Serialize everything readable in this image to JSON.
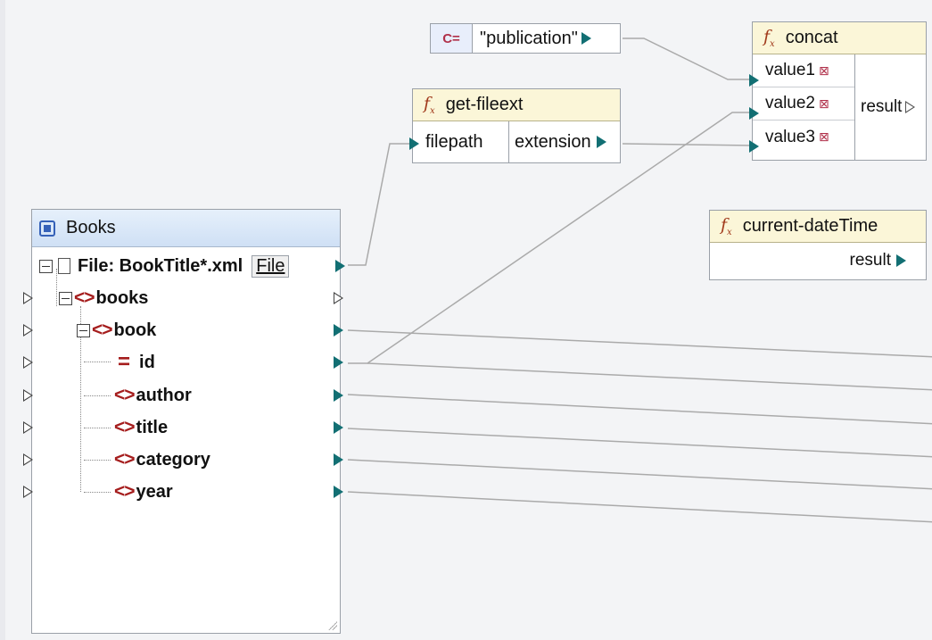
{
  "constant": {
    "tag": "C=",
    "value": "\"publication\""
  },
  "get_fileext": {
    "title": "get-fileext",
    "input": "filepath",
    "output": "extension"
  },
  "concat": {
    "title": "concat",
    "inputs": [
      "value1",
      "value2",
      "value3"
    ],
    "output": "result"
  },
  "current_datetime": {
    "title": "current-dateTime",
    "output": "result"
  },
  "books": {
    "title": "Books",
    "file_label": "File: BookTitle*.xml",
    "file_port": "File",
    "nodes": [
      "books",
      "book",
      "id",
      "author",
      "title",
      "category",
      "year"
    ]
  },
  "icons": {
    "function": "fx-icon",
    "collapse": "minus-box-icon",
    "element": "element-tag-icon",
    "attribute": "attribute-icon",
    "file": "document-icon"
  },
  "colors": {
    "port": "#126f73",
    "element_icon": "#a51d1d",
    "function_header": "#fbf6d8",
    "component_header": "#cfe0f5"
  }
}
